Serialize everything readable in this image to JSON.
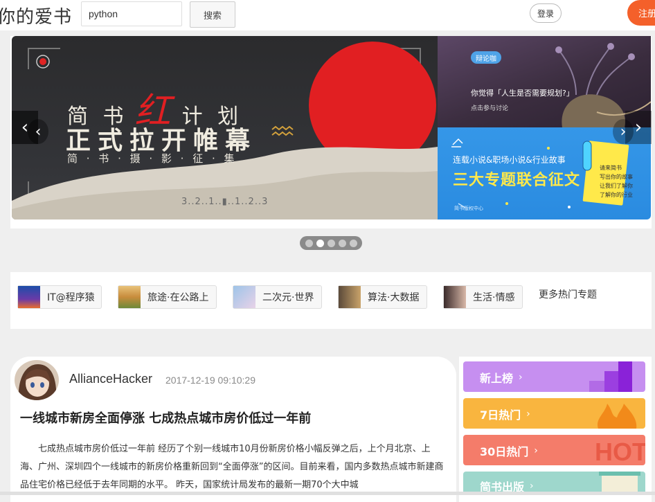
{
  "header": {
    "brand": "你的爱书",
    "search_value": "python",
    "search_button": "搜索",
    "login": "登录",
    "register": "注册"
  },
  "carousel": {
    "main_banner": {
      "line1": "简 书",
      "line1_highlight": "红",
      "line1_end": "计 划",
      "line2": "正式拉开帷幕",
      "line3": "简 · 书 · 摄 · 影 · 征 · 集",
      "countdown": "3..2..1..▮..1..2..3"
    },
    "side_top": {
      "badge": "辩论咖",
      "question": "你觉得「人生是否需要规划?」",
      "cta": "点击参与讨论"
    },
    "side_bottom": {
      "subtitle": "连载小说&职场小说&行业故事",
      "title": "三大专题联合征文",
      "note_lines": [
        "请来简书",
        "写出你的故事",
        "让我们了解你",
        "了解你的行业"
      ],
      "footer": "简书版权中心"
    },
    "dots_count": 5,
    "active_dot": 2
  },
  "topics": [
    {
      "label": "IT@程序猿",
      "color1": "#1d4ea8",
      "color2": "#e86d2e"
    },
    {
      "label": "旅途·在公路上",
      "color1": "#c88c3c",
      "color2": "#6e8a3a"
    },
    {
      "label": "二次元·世界",
      "color1": "#9ec4e8",
      "color2": "#e8d2e8"
    },
    {
      "label": "算法·大数据",
      "color1": "#5b4a3a",
      "color2": "#c9a36a"
    },
    {
      "label": "生活·情感",
      "color1": "#3a2a2a",
      "color2": "#d8b8a8"
    }
  ],
  "more_topics": "更多热门专题",
  "article": {
    "author": "AllianceHacker",
    "date": "2017-12-19 09:10:29",
    "title": "一线城市新房全面停涨 七成热点城市房价低过一年前",
    "body": "七成热点城市房价低过一年前 经历了个别一线城市10月份新房价格小幅反弹之后，上个月北京、上海、广州、深圳四个一线城市的新房价格重新回到“全面停涨”的区间。目前来看，国内多数热点城市新建商品住宅价格已经低于去年同期的水平。 昨天，国家统计局发布的最新一期70个大中城"
  },
  "rankings": [
    {
      "label": "新上榜",
      "color": "#c68ff0"
    },
    {
      "label": "7日热门",
      "color": "#f9b53f"
    },
    {
      "label": "30日热门",
      "color": "#f47c6a"
    },
    {
      "label": "简书出版",
      "color": "#9ed7cc"
    }
  ],
  "colors": {
    "accent": "#f4602a",
    "page_bg": "#efefef"
  }
}
